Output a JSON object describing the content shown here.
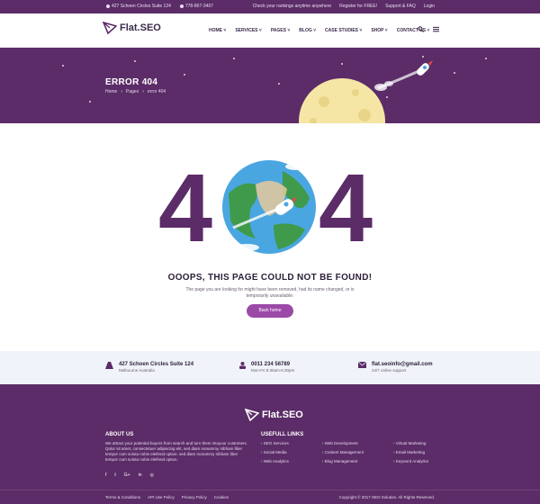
{
  "topbar": {
    "address": "427 Schoen Circles Suite 124",
    "phone": "778-867-3407",
    "links": [
      "Check your rankings anytime anywhere",
      "Register for FREE!",
      "Support & FAQ",
      "Login"
    ]
  },
  "brand": {
    "name": "Flat.SEO"
  },
  "nav": {
    "items": [
      "HOME",
      "SERVICES",
      "PAGES",
      "BLOG",
      "CASE STUDIES",
      "SHOP",
      "CONTACT US"
    ]
  },
  "hero": {
    "title": "ERROR 404",
    "breadcrumb": [
      "Home",
      "Pages",
      "error 404"
    ]
  },
  "error": {
    "digit_left": "4",
    "digit_right": "4",
    "heading": "OOOPS, THIS PAGE COULD NOT BE FOUND!",
    "message": "The page you are looking for might have been removed, had its name changed, or is temporarily unavailable.",
    "button": "Back home"
  },
  "contact": {
    "address_line1": "427 Schoen Circles Suite 124",
    "address_line2": "Melbourne Australia",
    "phone_line1": "0011 234 56789",
    "phone_line2": "Mon-Fri 8:30am-6:30pm",
    "email_line1": "flat.seoinfo@gmail.com",
    "email_line2": "24/7 online support"
  },
  "footer": {
    "about_title": "ABOUT US",
    "about_text": "We attract your potential buyers from search and turn them intoyour customers. Qolor sit amet, consectetuer adipiscing elit, sed diam nonummy nibham liber tempor cum soluta nobis eleifend option. sed diam nonummy nibham liber tempor cum soluta nobis eleifend option.",
    "social": [
      "f",
      "t",
      "G+",
      "in",
      "◎"
    ],
    "links_title": "USEFULL LINKS",
    "links_col1": [
      "SEO Services",
      "Social Media",
      "Web Analytics"
    ],
    "links_col2": [
      "Web Development",
      "Content Management",
      "Blog Management"
    ],
    "links_col3": [
      "Virtual Marketing",
      "Email Marketing",
      "Keyword Analytics"
    ],
    "bottom_links": [
      "Terms & Conditions",
      "API Use Policy",
      "Privacy Policy",
      "Cookies"
    ],
    "copyright": "Copyright © 2017 SEO Solution. All Rights Reserved."
  },
  "colors": {
    "purple": "#5b2c67",
    "button": "#9c4aa8"
  }
}
